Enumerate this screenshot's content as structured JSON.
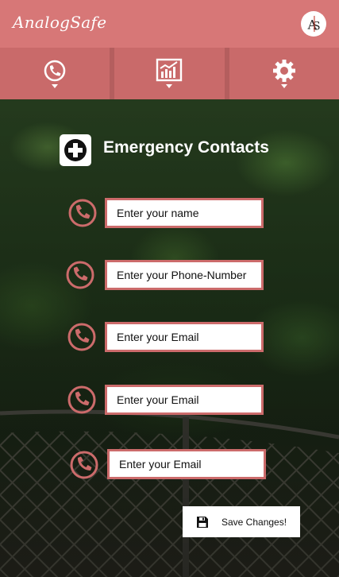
{
  "app": {
    "title": "AnalogSafe",
    "logo_icon": "as-compass-logo"
  },
  "nav": {
    "tabs": [
      {
        "icon": "phone-icon"
      },
      {
        "icon": "chart-icon"
      },
      {
        "icon": "gear-icon"
      }
    ]
  },
  "section": {
    "title": "Emergency Contacts",
    "icon": "plus-icon"
  },
  "form": {
    "fields": [
      {
        "placeholder": "Enter your name",
        "icon": "phone-icon"
      },
      {
        "placeholder": "Enter your Phone-Number",
        "icon": "phone-icon"
      },
      {
        "placeholder": "Enter your Email",
        "icon": "phone-icon"
      },
      {
        "placeholder": "Enter your Email",
        "icon": "phone-icon"
      },
      {
        "placeholder": "Enter your Email",
        "icon": "phone-icon"
      }
    ]
  },
  "save": {
    "label": "Save Changes!",
    "icon": "floppy-disk-icon"
  },
  "colors": {
    "accent": "#d77777",
    "nav": "#c96a6a",
    "field_border": "#cc6b6b"
  }
}
